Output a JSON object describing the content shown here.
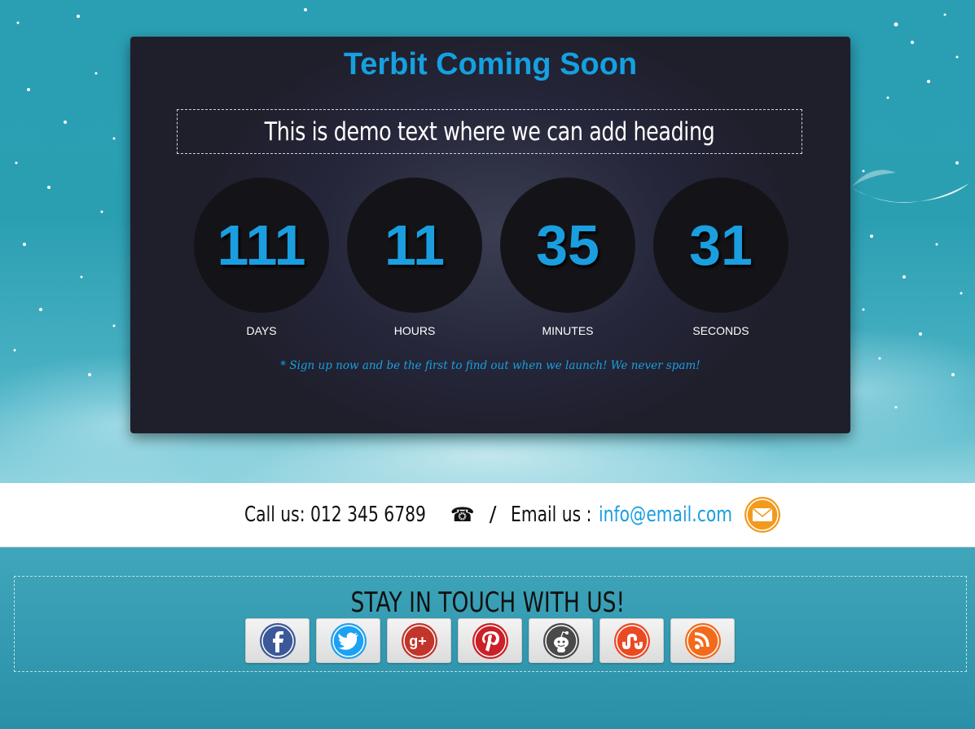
{
  "page": {
    "title": "Terbit Coming Soon",
    "headline": "This is demo text where we can add heading",
    "signup_note": "* Sign up now and be the first to find out when we launch! We never spam!"
  },
  "countdown": [
    {
      "value": "111",
      "label": "DAYS"
    },
    {
      "value": "11",
      "label": "HOURS"
    },
    {
      "value": "35",
      "label": "MINUTES"
    },
    {
      "value": "31",
      "label": "SECONDS"
    }
  ],
  "contact": {
    "call_label": "Call us: 012 345 6789",
    "phone_icon": "☎",
    "separator": "/",
    "email_label": "Email us :",
    "email": "info@email.com"
  },
  "social": {
    "title": "STAY IN TOUCH WITH US!",
    "buttons": [
      {
        "name": "facebook",
        "color": "#3b5998"
      },
      {
        "name": "twitter",
        "color": "#1da1f2"
      },
      {
        "name": "google-plus",
        "color": "#c1352b"
      },
      {
        "name": "pinterest",
        "color": "#cb2027"
      },
      {
        "name": "reddit",
        "color": "#4a4a4a"
      },
      {
        "name": "stumbleupon",
        "color": "#eb4924"
      },
      {
        "name": "rss",
        "color": "#f26b1d"
      }
    ]
  },
  "colors": {
    "accent": "#1a9ee0",
    "panel": "#23243a",
    "mail_icon": "#f39a1e"
  }
}
